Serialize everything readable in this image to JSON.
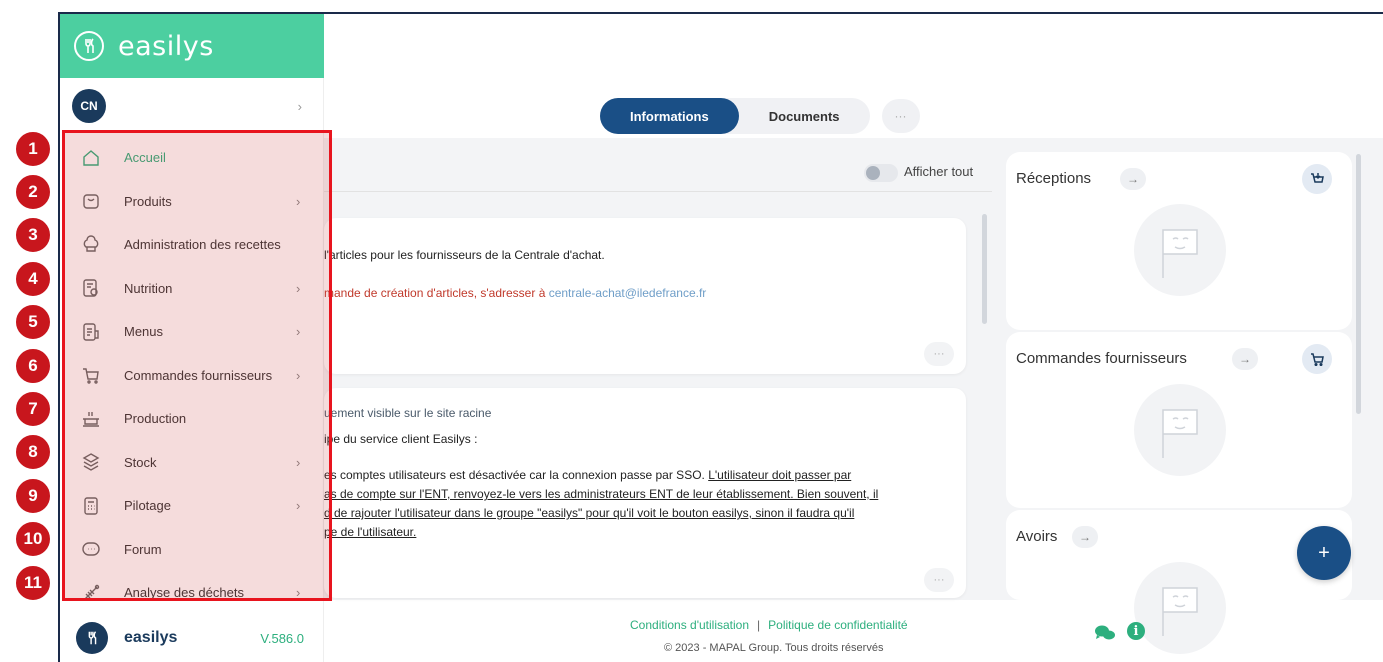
{
  "app": {
    "brand": "easilys",
    "user_initials": "CN",
    "version": "V.586.0"
  },
  "sidebar": {
    "items": [
      {
        "num": "1",
        "label": "Accueil",
        "icon": "home-icon",
        "chevron": false,
        "active": true
      },
      {
        "num": "2",
        "label": "Produits",
        "icon": "bag-icon",
        "chevron": true
      },
      {
        "num": "3",
        "label": "Administration des recettes",
        "icon": "chef-hat-icon",
        "chevron": false
      },
      {
        "num": "4",
        "label": "Nutrition",
        "icon": "nutrition-icon",
        "chevron": true
      },
      {
        "num": "5",
        "label": "Menus",
        "icon": "menu-icon",
        "chevron": true
      },
      {
        "num": "6",
        "label": "Commandes fournisseurs",
        "icon": "cart-icon",
        "chevron": true
      },
      {
        "num": "7",
        "label": "Production",
        "icon": "cooking-pot-icon",
        "chevron": false
      },
      {
        "num": "8",
        "label": "Stock",
        "icon": "boxes-icon",
        "chevron": true
      },
      {
        "num": "9",
        "label": "Pilotage",
        "icon": "calculator-icon",
        "chevron": true
      },
      {
        "num": "10",
        "label": "Forum",
        "icon": "chat-bubble-icon",
        "chevron": false
      },
      {
        "num": "11",
        "label": "Analyse des déchets",
        "icon": "fishbone-icon",
        "chevron": true
      }
    ],
    "chevron_glyph": "›"
  },
  "tabs": {
    "items": [
      "Informations",
      "Documents"
    ],
    "active": 0,
    "more": "···"
  },
  "toolbar": {
    "show_all": "Afficher tout"
  },
  "cards": {
    "card1": {
      "line1": "l'articles pour les fournisseurs de la Centrale d'achat.",
      "line2_prefix": "mande de création d'articles, s'adresser à ",
      "email": "centrale-achat@iledefrance.fr",
      "more": "···"
    },
    "card2": {
      "line1": "uement visible sur le site racine",
      "line2": "ipe du service client Easilys :",
      "line3_plain": "es comptes utilisateurs est désactivée car la connexion passe par SSO. ",
      "line3_underlined": "L'utilisateur doit passer par",
      "line4": "as de compte sur l'ENT, renvoyez-le vers les administrateurs ENT de leur établissement. Bien souvent, il",
      "line5": "d de rajouter l'utilisateur dans le groupe \"easilys\" pour qu'il voit le bouton easilys, sinon il faudra qu'il",
      "line6": "pe de l'utilisateur.",
      "more": "···"
    }
  },
  "widgets": [
    {
      "title": "Réceptions",
      "arrow": "→",
      "icon": "reception-icon"
    },
    {
      "title": "Commandes fournisseurs",
      "arrow": "→",
      "icon": "cart-icon"
    },
    {
      "title": "Avoirs",
      "arrow": "→",
      "icon": "credit-note-icon"
    }
  ],
  "fab": "+",
  "footer": {
    "terms": "Conditions d'utilisation",
    "separator": "|",
    "privacy": "Politique de confidentialité",
    "copyright": "© 2023 - MAPAL Group. Tous droits réservés",
    "info_glyph": "i"
  },
  "colors": {
    "brand_green": "#4ccfa0",
    "accent_green": "#2daf7e",
    "navy": "#1a4f86",
    "highlight_red": "#e8141e",
    "badge_red": "#c8161d"
  }
}
